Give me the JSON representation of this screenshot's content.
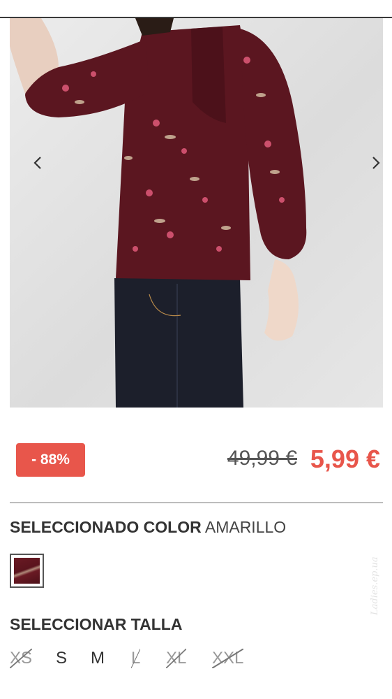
{
  "product": {
    "discount_badge": "- 88%",
    "old_price": "49,99 €",
    "new_price": "5,99 €"
  },
  "color": {
    "heading_bold": "SELECCIONADO COLOR",
    "heading_value": "AMARILLO",
    "swatch_color": "#6a1a24"
  },
  "size": {
    "heading": "SELECCIONAR TALLA",
    "options": [
      {
        "label": "XS",
        "available": false
      },
      {
        "label": "S",
        "available": true
      },
      {
        "label": "M",
        "available": true
      },
      {
        "label": "L",
        "available": false
      },
      {
        "label": "XL",
        "available": false
      },
      {
        "label": "XXL",
        "available": false
      }
    ]
  },
  "gallery": {
    "prev_icon": "chevron-left-icon",
    "next_icon": "chevron-right-icon"
  },
  "watermark": "Ladies.ep.ua",
  "colors": {
    "accent": "#e8564b",
    "text": "#333333",
    "divider": "#bdbdbd"
  }
}
